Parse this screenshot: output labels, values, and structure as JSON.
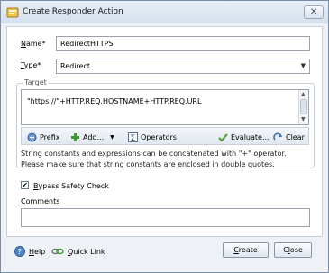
{
  "window": {
    "title": "Create Responder Action",
    "close_label": "✕"
  },
  "form": {
    "name_label": "Name*",
    "name_value": "RedirectHTTPS",
    "type_label": "Type*",
    "type_value": "Redirect",
    "target_label": "Target",
    "target_expression": "\"https://\"+HTTP.REQ.HOSTNAME+HTTP.REQ.URL",
    "toolbar": {
      "prefix": "Prefix",
      "add": "Add...",
      "operators": "Operators",
      "evaluate": "Evaluate...",
      "clear": "Clear"
    },
    "help_line1": "String constants and expressions can be concatenated with \"+\" operator.",
    "help_line2": "Please make sure that string constants are enclosed in double quotes.",
    "bypass_label": "Bypass Safety Check",
    "bypass_checked": "✔",
    "comments_label": "Comments",
    "comments_value": ""
  },
  "footer": {
    "help": "Help",
    "quick_link": "Quick Link",
    "create": "Create",
    "close": "Close"
  },
  "colors": {
    "accent": "#3a6fb0",
    "plus_green": "#3c9a2e",
    "check_green": "#4a9c2f"
  },
  "icons": [
    "app-icon",
    "close-icon",
    "prefix-icon",
    "add-icon",
    "operators-icon",
    "evaluate-icon",
    "clear-icon",
    "help-icon",
    "quick-link-icon"
  ]
}
